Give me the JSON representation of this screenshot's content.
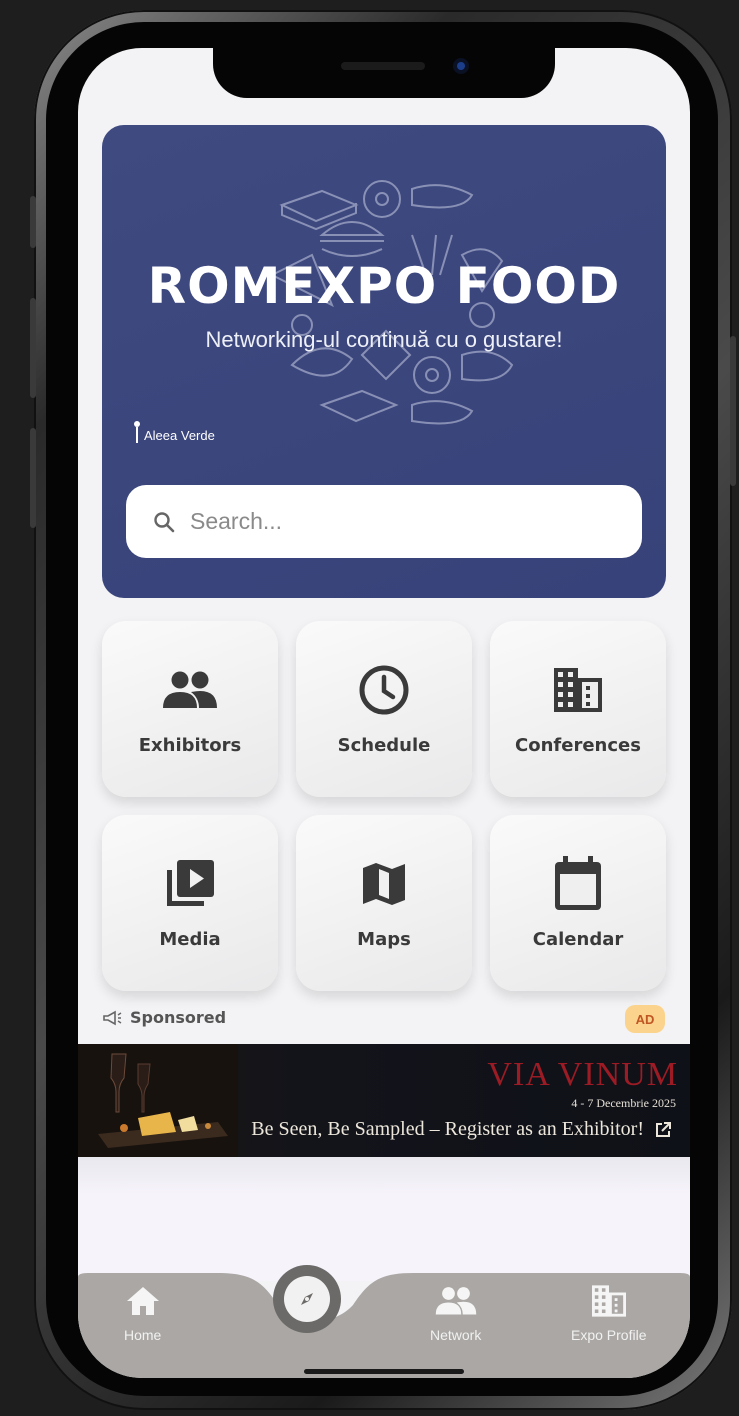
{
  "hero": {
    "title": "ROMEXPO FOOD",
    "subtitle": "Networking-ul continuă cu o gustare!",
    "location": "Aleea Verde",
    "background_color": "#3e4a80"
  },
  "search": {
    "placeholder": "Search..."
  },
  "tiles": [
    {
      "label": "Exhibitors",
      "icon": "people-icon"
    },
    {
      "label": "Schedule",
      "icon": "clock-icon"
    },
    {
      "label": "Conferences",
      "icon": "building-icon"
    },
    {
      "label": "Media",
      "icon": "video-library-icon"
    },
    {
      "label": "Maps",
      "icon": "map-icon"
    },
    {
      "label": "Calendar",
      "icon": "calendar-icon"
    }
  ],
  "sponsored": {
    "label": "Sponsored",
    "badge": "AD",
    "icon": "megaphone-icon"
  },
  "banner": {
    "title": "VIA VINUM",
    "dates": "4 - 7 Decembrie 2025",
    "cta": "Be Seen, Be Sampled – Register as an Exhibitor!",
    "accent_color": "#9c1b24"
  },
  "bottom_nav": {
    "items": [
      {
        "label": "Home",
        "icon": "home-icon"
      },
      {
        "label": "",
        "icon": "compass-icon"
      },
      {
        "label": "Network",
        "icon": "people-icon"
      },
      {
        "label": "Expo Profile",
        "icon": "building-icon"
      }
    ],
    "background_color": "#aaa7a4"
  }
}
